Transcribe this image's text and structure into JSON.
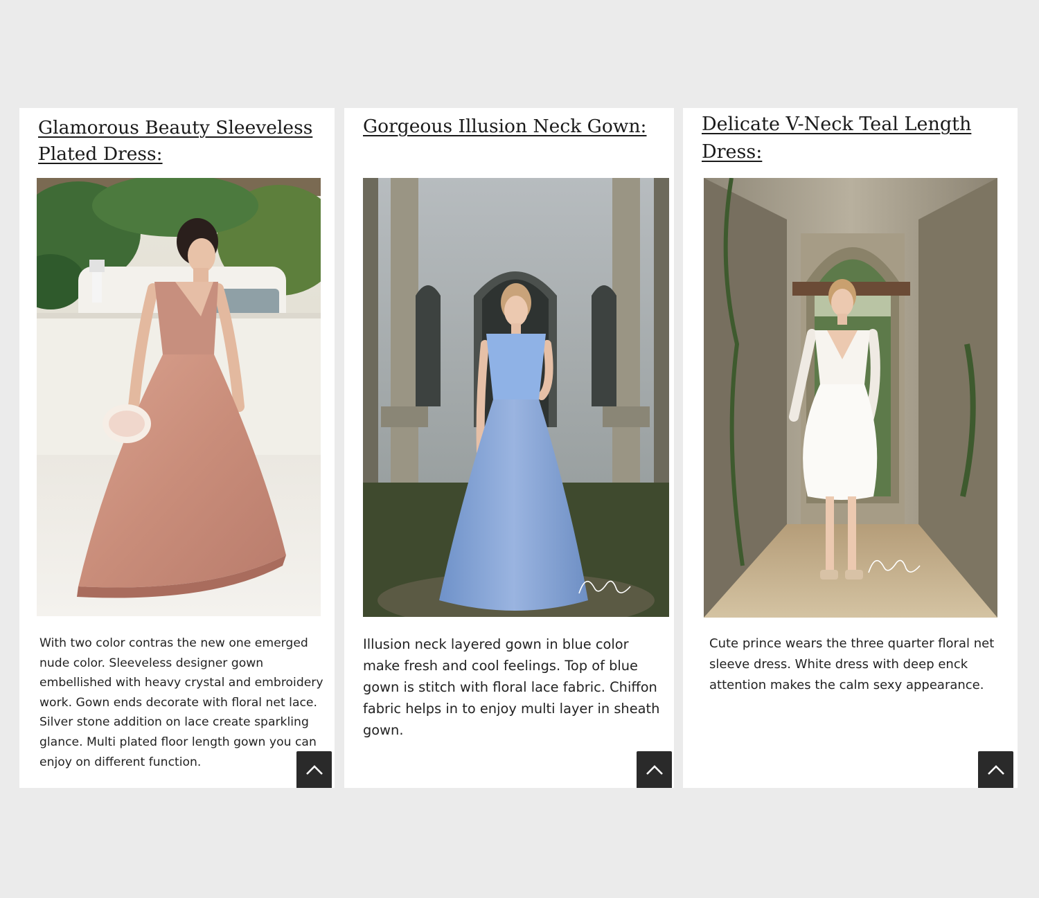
{
  "cards": [
    {
      "title": "Glamorous Beauty Sleeveless Plated Dress:",
      "description": "With two color contras the new one emerged nude color. Sleeveless designer gown embellished with heavy crystal and embroidery work. Gown ends decorate with floral net lace. Silver stone addition on lace create sparkling glance. Multi plated floor length gown you can enjoy on different function.",
      "image_subject": "blush-pink tulle gown with lace bodice, woman holding bouquet",
      "back_to_top_icon": "chevron-up-icon"
    },
    {
      "title": "Gorgeous Illusion Neck Gown:",
      "description": "Illusion neck layered gown in blue color make fresh and cool feelings. Top of blue gown is stitch with floral lace fabric. Chiffon fabric helps in to enjoy multi layer in sheath gown.",
      "image_subject": "light blue layered gown in front of weathered building",
      "signature": "Chrystelle Atallah",
      "back_to_top_icon": "chevron-up-icon"
    },
    {
      "title": "Delicate V-Neck Teal Length Dress:",
      "description": "Cute prince wears the three quarter floral net sleeve dress. White dress with deep enck attention makes the calm sexy appearance.",
      "image_subject": "short white V-neck dress with lace sleeves in stone corridor",
      "signature": "Chrystelle Atallah",
      "back_to_top_icon": "chevron-up-icon"
    }
  ],
  "colors": {
    "page_background": "#ebebeb",
    "card_background": "#ffffff",
    "button_background": "#2a2a2a",
    "title_text": "#1a1a1a",
    "body_text": "#222222"
  }
}
